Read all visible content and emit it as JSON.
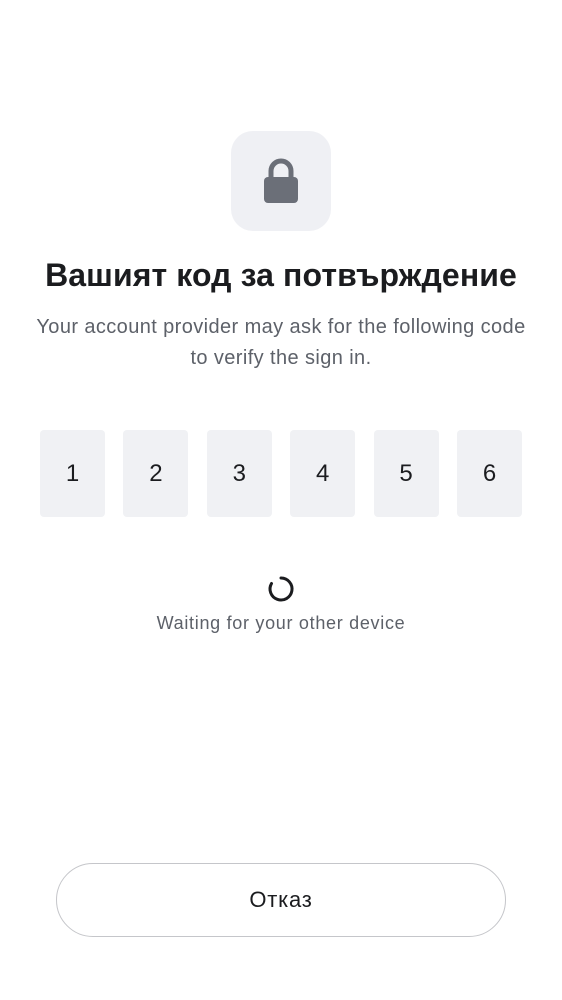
{
  "icon": {
    "name": "lock-icon",
    "color": "#6b6f78",
    "tile_color": "#eff0f4"
  },
  "title": "Вашият код за потвърждение",
  "subtitle": "Your account provider may ask for the following code to verify the sign in.",
  "code": {
    "digits": [
      "1",
      "2",
      "3",
      "4",
      "5",
      "6"
    ]
  },
  "status": {
    "spinner_icon": "loading-spinner-icon",
    "text": "Waiting for your other device"
  },
  "cancel_button": {
    "label": "Отказ"
  }
}
